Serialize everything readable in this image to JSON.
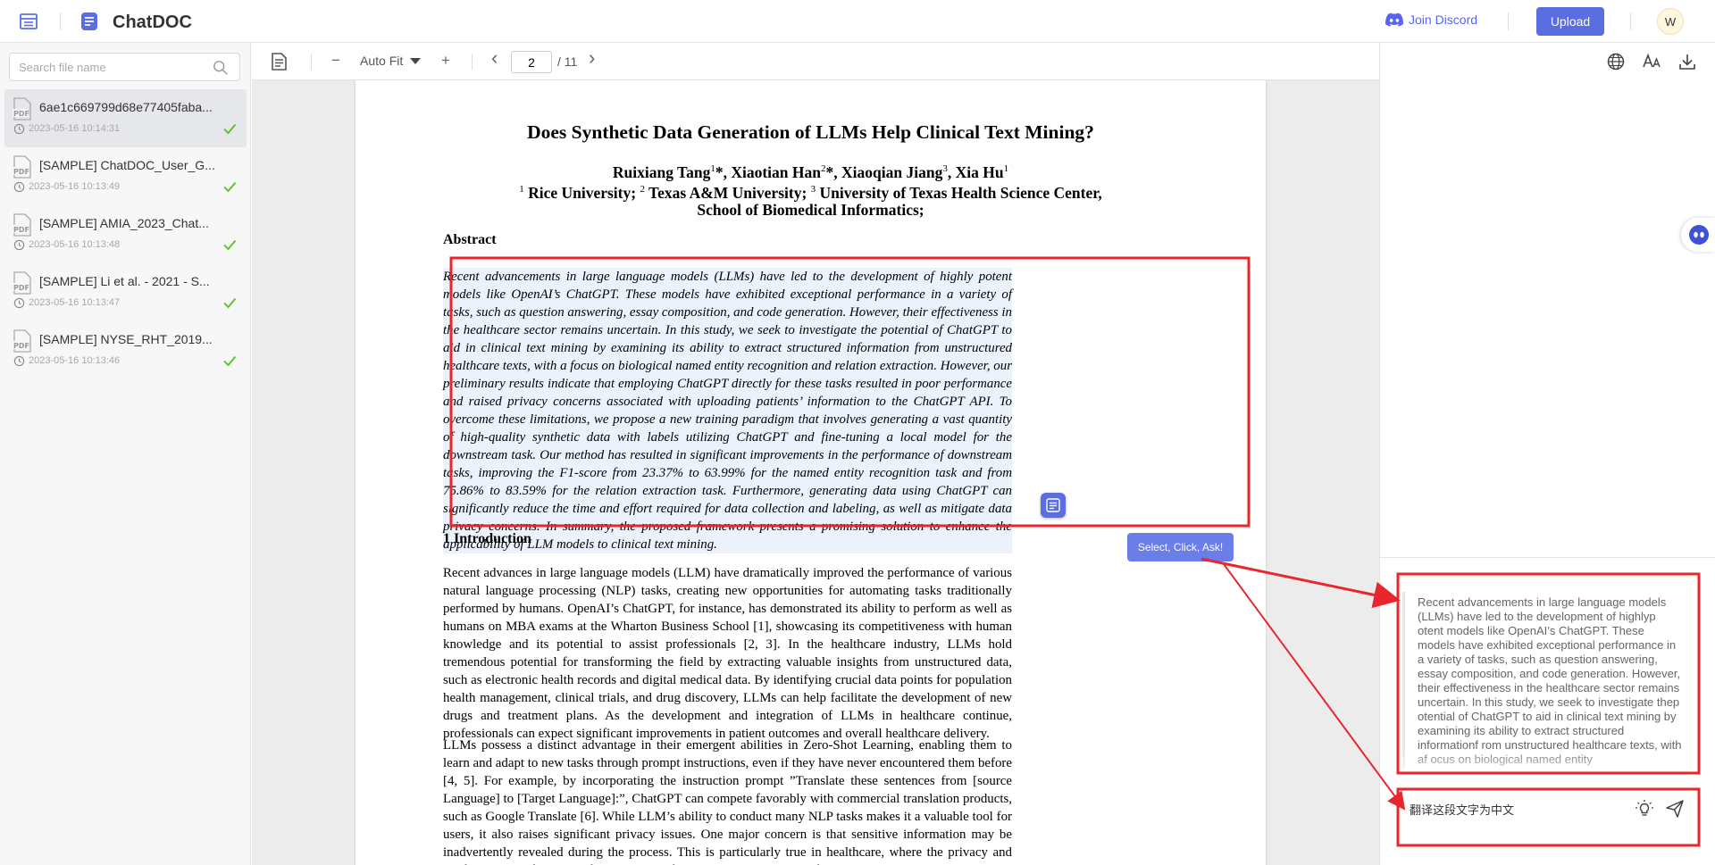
{
  "app": {
    "title": "ChatDOC"
  },
  "header": {
    "discord_label": "Join Discord",
    "upload_label": "Upload",
    "avatar_letter": "W"
  },
  "sidebar": {
    "search_placeholder": "Search file name",
    "files": [
      {
        "name": "6ae1c669799d68e77405faba...",
        "date": "2023-05-16 10:14:31",
        "active": true
      },
      {
        "name": "[SAMPLE] ChatDOC_User_G...",
        "date": "2023-05-16 10:13:49",
        "active": false
      },
      {
        "name": "[SAMPLE] AMIA_2023_Chat...",
        "date": "2023-05-16 10:13:48",
        "active": false
      },
      {
        "name": "[SAMPLE] Li et al. - 2021 - S...",
        "date": "2023-05-16 10:13:47",
        "active": false
      },
      {
        "name": "[SAMPLE] NYSE_RHT_2019...",
        "date": "2023-05-16 10:13:46",
        "active": false
      }
    ]
  },
  "viewer": {
    "zoom_minus": "−",
    "zoom_label": "Auto Fit",
    "zoom_plus": "+",
    "prev": "‹",
    "next": "›",
    "page_current": "2",
    "page_total": "/ 11"
  },
  "paper": {
    "title": "Does Synthetic Data Generation of LLMs Help Clinical Text Mining?",
    "authors": {
      "a1": "Ruixiang Tang",
      "a1_sup": "1",
      "a1_mark": "*, ",
      "a2": "Xiaotian Han",
      "a2_sup": "2",
      "a2_mark": "*, ",
      "a3": "Xiaoqian Jiang",
      "a3_sup": "3",
      "a3_mark": ", ",
      "a4": "Xia Hu",
      "a4_sup": "1"
    },
    "affil": {
      "s1": "1",
      "t1": " Rice University; ",
      "s2": "2",
      "t2": " Texas A&M University; ",
      "s3": "3",
      "t3": " University of Texas Health Science Center,",
      "line2": "School of Biomedical Informatics;"
    },
    "abstract_heading": "Abstract",
    "abstract": "Recent advancements in large language models (LLMs) have led to the development of highly potent models like OpenAI’s ChatGPT. These models have exhibited exceptional performance in a variety of tasks, such as question answering, essay composition, and code generation. However, their effectiveness in the healthcare sector remains uncertain. In this study, we seek to investigate the potential of ChatGPT to aid in clinical text mining by examining its ability to extract structured information from unstructured healthcare texts, with a focus on biological named entity recognition and relation extraction. However, our preliminary results indicate that employing ChatGPT directly for these tasks resulted in poor performance and raised privacy concerns associated with uploading patients’ information to the ChatGPT API. To overcome these limitations, we propose a new training paradigm that involves generating a vast quantity of high-quality synthetic data with labels utilizing ChatGPT and fine-tuning a local model for the downstream task. Our method has resulted in significant improvements in the performance of downstream tasks, improving the F1-score from 23.37% to 63.99% for the named entity recognition task and from 75.86% to 83.59% for the relation extraction task. Furthermore, generating data using ChatGPT can significantly reduce the time and effort required for data collection and labeling, as well as mitigate data privacy concerns. In summary, the proposed framework presents a promising solution to enhance the applicability of LLM models to clinical text mining.",
    "intro_heading": "1   Introduction",
    "intro_p1": "Recent advances in large language models (LLM) have dramatically improved the performance of various natural language processing (NLP) tasks, creating new opportunities for automating tasks traditionally performed by humans. OpenAI’s ChatGPT, for instance, has demonstrated its ability to perform as well as humans on MBA exams at the Wharton Business School [1], showcasing its competitiveness with human knowledge and its potential to assist professionals [2, 3]. In the healthcare industry, LLMs hold tremendous potential for transforming the field by extracting valuable insights from unstructured data, such as electronic health records and digital medical data. By identifying crucial data points for population health management, clinical trials, and drug discovery, LLMs can help facilitate the development of new drugs and treatment plans. As the development and integration of LLMs in healthcare continue, professionals can expect significant improvements in patient outcomes and overall healthcare delivery.",
    "intro_p2": "LLMs possess a distinct advantage in their emergent abilities in Zero-Shot Learning, enabling them to learn and adapt to new tasks through prompt instructions, even if they have never encountered them before [4, 5]. For example, by incorporating the instruction prompt ”Translate these sentences from [source Language] to [Target Language]:”, ChatGPT can compete favorably with commercial translation products, such as Google Translate [6]. While LLM’s ability to conduct many NLP tasks makes it a valuable tool for users, it also raises significant privacy issues. One major concern is that sensitive information may be inadvertently revealed during the process. This is particularly true in healthcare, where the privacy and confidentiality of patient information are of utmost importance. Therefore, it is"
  },
  "tooltip": {
    "label": "Select, Click, Ask!"
  },
  "chat": {
    "quote": "Recent advancements in large language models (LLMs) have led to the development of highlyp otent models like OpenAI’s ChatGPT. These models have exhibited exceptional performance in a variety of tasks, such as question answering, essay composition, and code generation. However, their effectiveness in the healthcare sector remains uncertain. In this study, we seek to investigate thep otential of ChatGPT to aid in clinical text mining by examining its ability to extract structured informationf rom unstructured healthcare texts, with af ocus on biological named entity",
    "input_value": "翻译这段文字为中文"
  },
  "colors": {
    "accent": "#5b6ee1",
    "annotation_red": "#e8262b",
    "discord": "#5865f2",
    "check_green": "#52c41a"
  }
}
